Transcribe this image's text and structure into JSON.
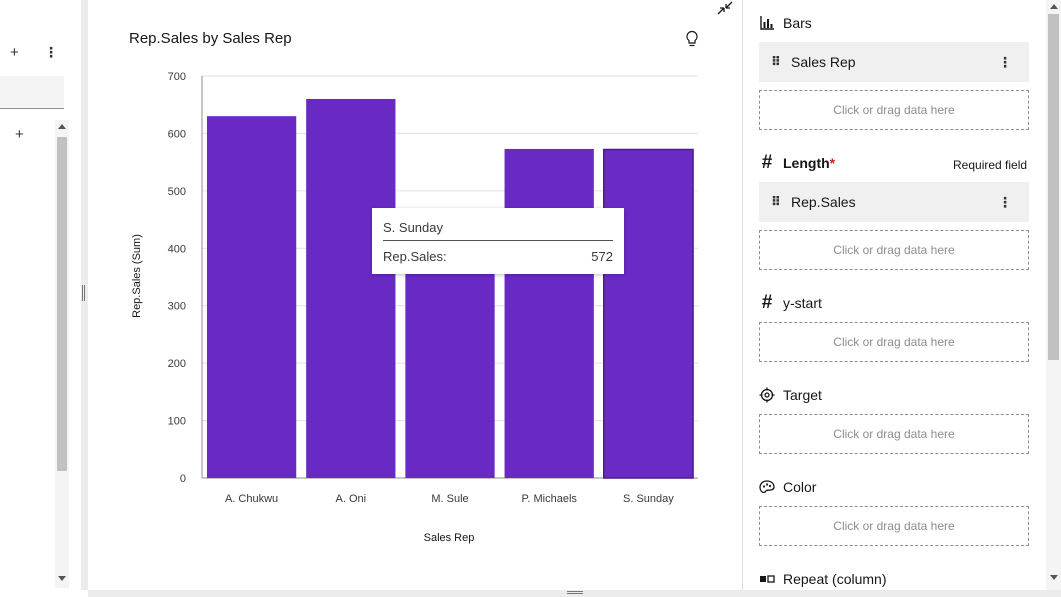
{
  "left_panel": {
    "plus_top": "+",
    "dots_top": "⋮",
    "plus_mid": "+"
  },
  "chart": {
    "title": "Rep.Sales by Sales Rep"
  },
  "chart_data": {
    "type": "bar",
    "title": "Rep.Sales by Sales Rep",
    "xlabel": "Sales Rep",
    "ylabel": "Rep.Sales (Sum)",
    "categories": [
      "A. Chukwu",
      "A. Oni",
      "M. Sule",
      "P. Michaels",
      "S. Sunday"
    ],
    "values": [
      630,
      660,
      400,
      573,
      572
    ],
    "ylim": [
      0,
      700
    ],
    "yticks": [
      0,
      100,
      200,
      300,
      400,
      500,
      600,
      700
    ],
    "grid": true,
    "bar_color": "#6929c4",
    "highlighted_bar_color": "#6a2ac6",
    "highlighted_index": 4
  },
  "tooltip": {
    "title": "S. Sunday",
    "label": "Rep.Sales:",
    "value": "572"
  },
  "right_panel": {
    "bars_label": "Bars",
    "bars_field": "Sales Rep",
    "length_label": "Length",
    "length_required_star": "*",
    "required_note": "Required field",
    "length_field": "Rep.Sales",
    "ystart_label": "y-start",
    "target_label": "Target",
    "color_label": "Color",
    "repeat_label": "Repeat (column)",
    "drop_text": "Click or drag data here"
  },
  "colors": {
    "accent": "#6929c4",
    "required": "#da1e28"
  }
}
